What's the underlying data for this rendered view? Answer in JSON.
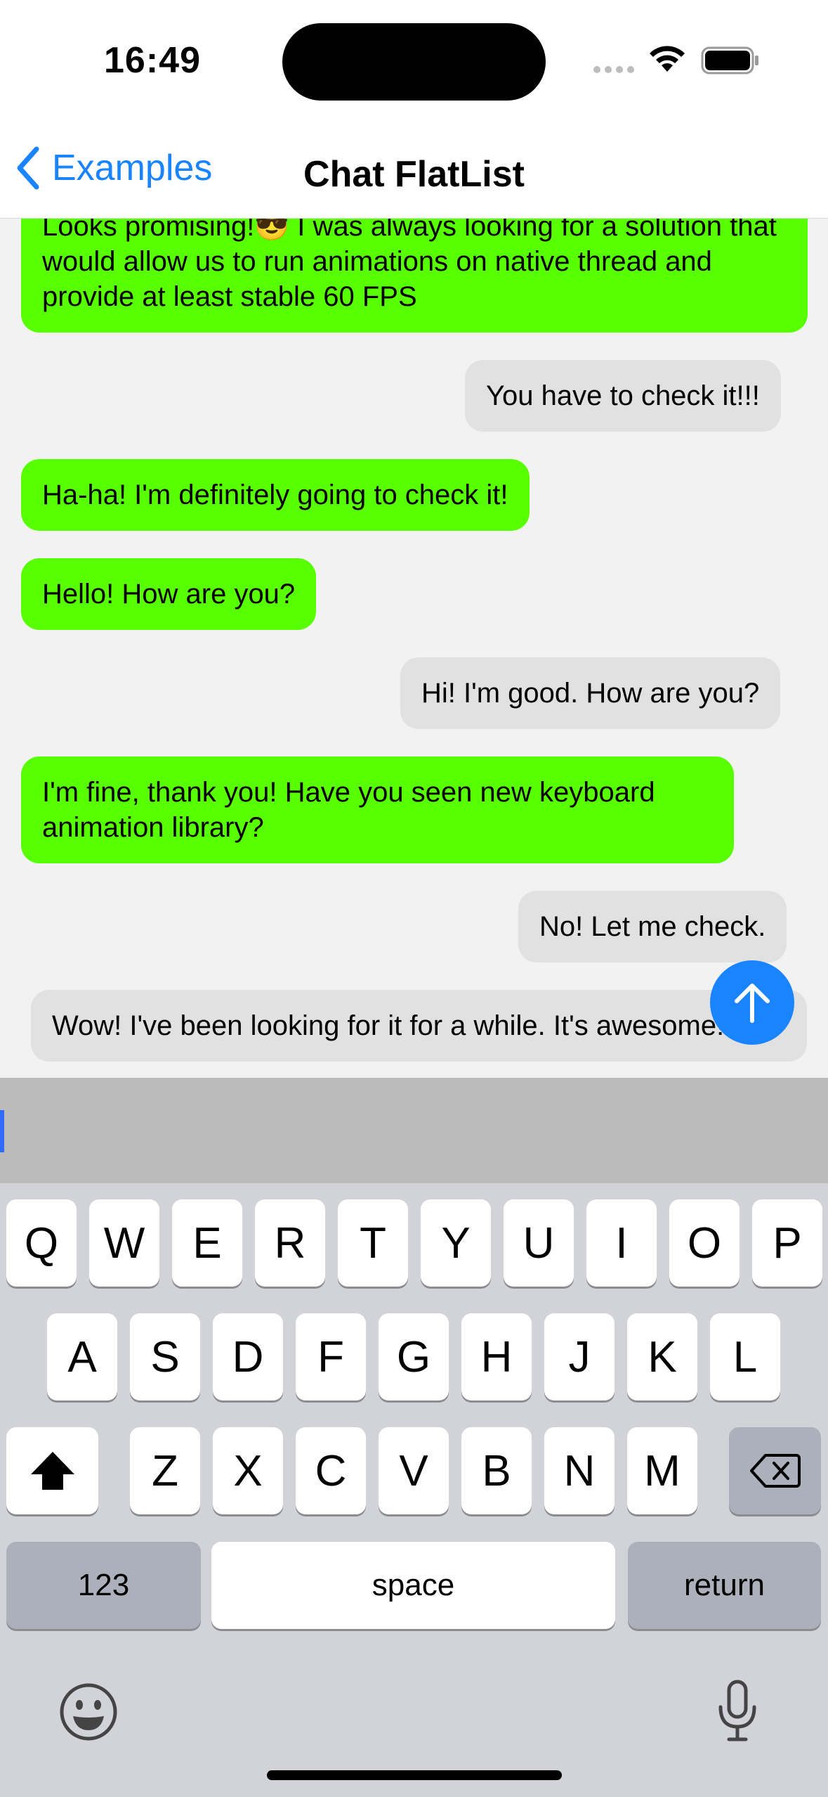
{
  "status_bar": {
    "time": "16:49"
  },
  "nav": {
    "back_label": "Examples",
    "title": "Chat FlatList"
  },
  "messages": [
    {
      "text": "Looks promising!😎 I was always looking for a solution that would allow us to run animations on native thread and provide at least stable 60 FPS",
      "side": "incoming"
    },
    {
      "text": "You have to check it!!!",
      "side": "outgoing"
    },
    {
      "text": "Ha-ha! I'm definitely going to check it!",
      "side": "incoming"
    },
    {
      "text": "Hello! How are you?",
      "side": "incoming"
    },
    {
      "text": "Hi! I'm good. How are you?",
      "side": "outgoing"
    },
    {
      "text": "I'm fine, thank you! Have you seen new keyboard animation library?",
      "side": "incoming"
    },
    {
      "text": "No! Let me check.",
      "side": "outgoing"
    },
    {
      "text": "Wow! I've been looking for it for a while. It's awesome!",
      "side": "outgoing"
    }
  ],
  "scroll_to_bottom": {
    "icon": "arrow-up-icon"
  },
  "composer": {
    "value": "",
    "placeholder": ""
  },
  "keyboard": {
    "row1": [
      "Q",
      "W",
      "E",
      "R",
      "T",
      "Y",
      "U",
      "I",
      "O",
      "P"
    ],
    "row2": [
      "A",
      "S",
      "D",
      "F",
      "G",
      "H",
      "J",
      "K",
      "L"
    ],
    "row3": [
      "Z",
      "X",
      "C",
      "V",
      "B",
      "N",
      "M"
    ],
    "numbers_label": "123",
    "space_label": "space",
    "return_label": "return",
    "icons": [
      "shift-icon",
      "backspace-icon",
      "emoji-icon",
      "microphone-icon"
    ]
  },
  "colors": {
    "incoming_bubble": "#57ff00",
    "outgoing_bubble": "#e1e1e1",
    "accent": "#1a84ff"
  }
}
